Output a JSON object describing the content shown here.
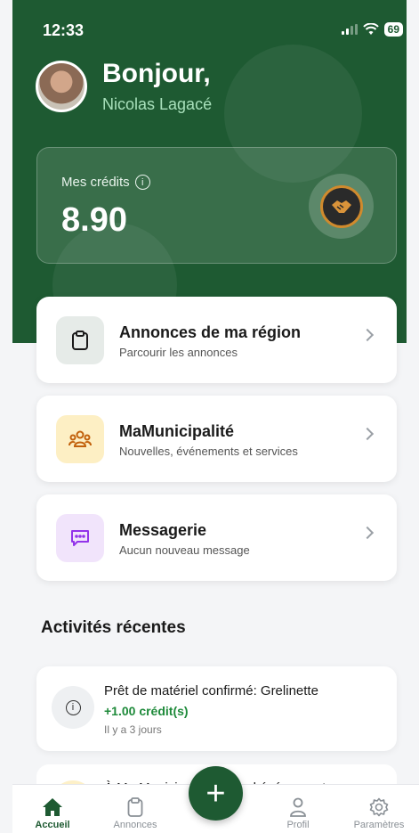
{
  "status_bar": {
    "time": "12:33",
    "battery": "69"
  },
  "header": {
    "greeting": "Bonjour,",
    "user_name": "Nicolas Lagacé"
  },
  "credits": {
    "label": "Mes crédits",
    "value": "8.90"
  },
  "menu": [
    {
      "title": "Annonces de ma région",
      "subtitle": "Parcourir les annonces",
      "icon": "clipboard-icon"
    },
    {
      "title": "MaMunicipalité",
      "subtitle": "Nouvelles, événements et services",
      "icon": "people-group-icon"
    },
    {
      "title": "Messagerie",
      "subtitle": "Aucun nouveau message",
      "icon": "message-icon"
    }
  ],
  "recent": {
    "title": "Activités récentes",
    "items": [
      {
        "title": "Prêt de matériel confirmé: Grelinette",
        "credit": "+1.00 crédit(s)",
        "time": "Il y a 3 jours"
      },
      {
        "title": "À Ma Municipalité, nouvel événement"
      }
    ]
  },
  "nav": {
    "home": "Accueil",
    "ads": "Annonces",
    "profile": "Profil",
    "settings": "Paramètres"
  },
  "colors": {
    "brand_green": "#1e5a32",
    "credit_green": "#1e8a3a"
  }
}
